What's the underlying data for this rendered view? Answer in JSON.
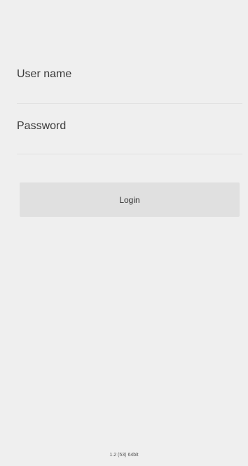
{
  "login_form": {
    "username_placeholder": "User name",
    "password_placeholder": "Password",
    "login_label": "Login"
  },
  "footer": {
    "version": "1.2 (53) 64bit"
  },
  "colors": {
    "background": "#efefef",
    "button": "#e0e0e0",
    "divider": "#e2e2e2"
  }
}
